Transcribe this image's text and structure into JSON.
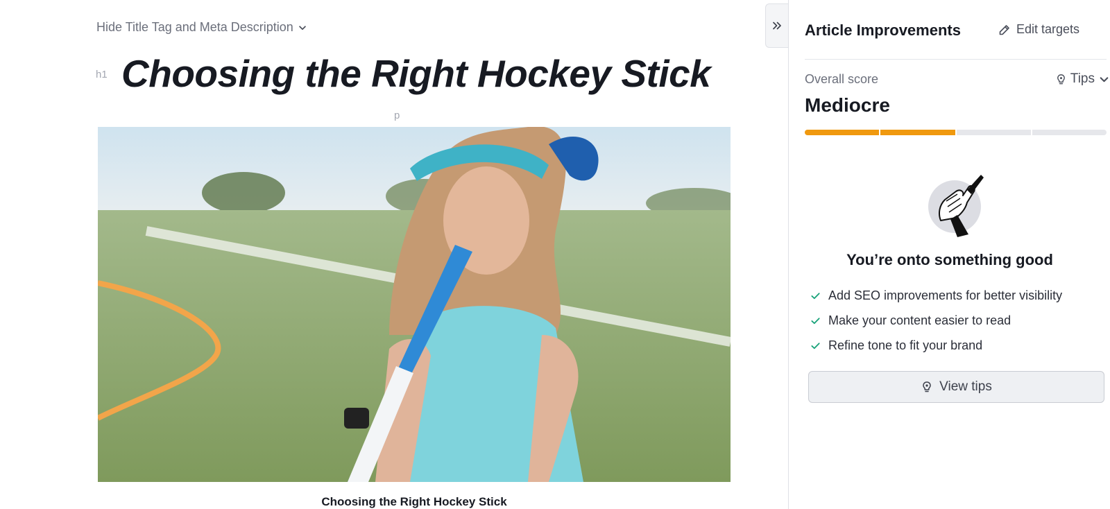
{
  "editor": {
    "meta_toggle_label": "Hide Title Tag and Meta Description",
    "h1_tag": "h1",
    "title": "Choosing the Right Hockey Stick",
    "p_tag": "p",
    "image_caption": "Choosing the Right Hockey Stick"
  },
  "panel": {
    "title": "Article Improvements",
    "edit_targets_label": "Edit targets",
    "score_label": "Overall score",
    "tips_label": "Tips",
    "score_value": "Mediocre",
    "score_segments_filled": 2,
    "score_segments_total": 4,
    "headline": "You’re onto something good",
    "checklist": [
      "Add SEO improvements for better visibility",
      "Make your content easier to read",
      "Refine tone to fit your brand"
    ],
    "view_tips_label": "View tips"
  },
  "colors": {
    "score_fill": "#f0990f",
    "score_empty": "#e6e7eb",
    "check": "#1aa37a"
  },
  "icons": {
    "meta_toggle": "chevron-down-icon",
    "collapse": "double-chevron-right-icon",
    "edit_targets": "pencil-icon",
    "tips": "lightbulb-icon",
    "checklist": "check-icon",
    "view_tips": "lightbulb-icon"
  }
}
